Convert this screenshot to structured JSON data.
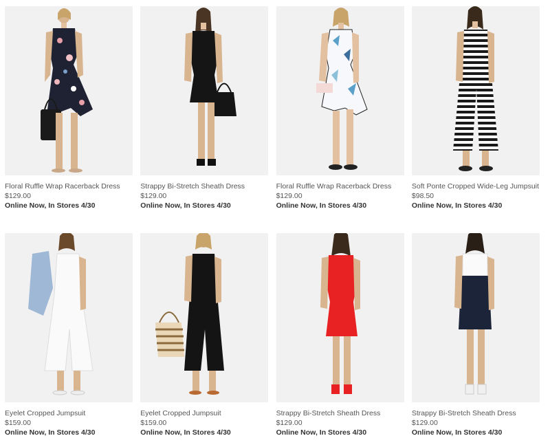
{
  "products": [
    {
      "name": "Floral Ruffle Wrap Racerback Dress",
      "price": "$129.00",
      "availability": "Online Now, In Stores 4/30",
      "image": "floral-navy-dress-image"
    },
    {
      "name": "Strappy Bi-Stretch Sheath Dress",
      "price": "$129.00",
      "availability": "Online Now, In Stores 4/30",
      "image": "black-sheath-dress-image"
    },
    {
      "name": "Floral Ruffle Wrap Racerback Dress",
      "price": "$129.00",
      "availability": "Online Now, In Stores 4/30",
      "image": "floral-white-dress-image"
    },
    {
      "name": "Soft Ponte Cropped Wide-Leg Jumpsuit",
      "price": "$98.50",
      "availability": "Online Now, In Stores 4/30",
      "image": "striped-jumpsuit-image"
    },
    {
      "name": "Eyelet Cropped Jumpsuit",
      "price": "$159.00",
      "availability": "Online Now, In Stores 4/30",
      "image": "white-eyelet-jumpsuit-image"
    },
    {
      "name": "Eyelet Cropped Jumpsuit",
      "price": "$159.00",
      "availability": "Online Now, In Stores 4/30",
      "image": "black-eyelet-jumpsuit-image"
    },
    {
      "name": "Strappy Bi-Stretch Sheath Dress",
      "price": "$129.00",
      "availability": "Online Now, In Stores 4/30",
      "image": "red-sheath-dress-image"
    },
    {
      "name": "Strappy Bi-Stretch Sheath Dress",
      "price": "$129.00",
      "availability": "Online Now, In Stores 4/30",
      "image": "navy-white-sheath-dress-image"
    }
  ],
  "colors": {
    "background": "#ffffff",
    "image_background": "#f1f1f1",
    "text": "#555555",
    "availability_text": "#333333"
  }
}
